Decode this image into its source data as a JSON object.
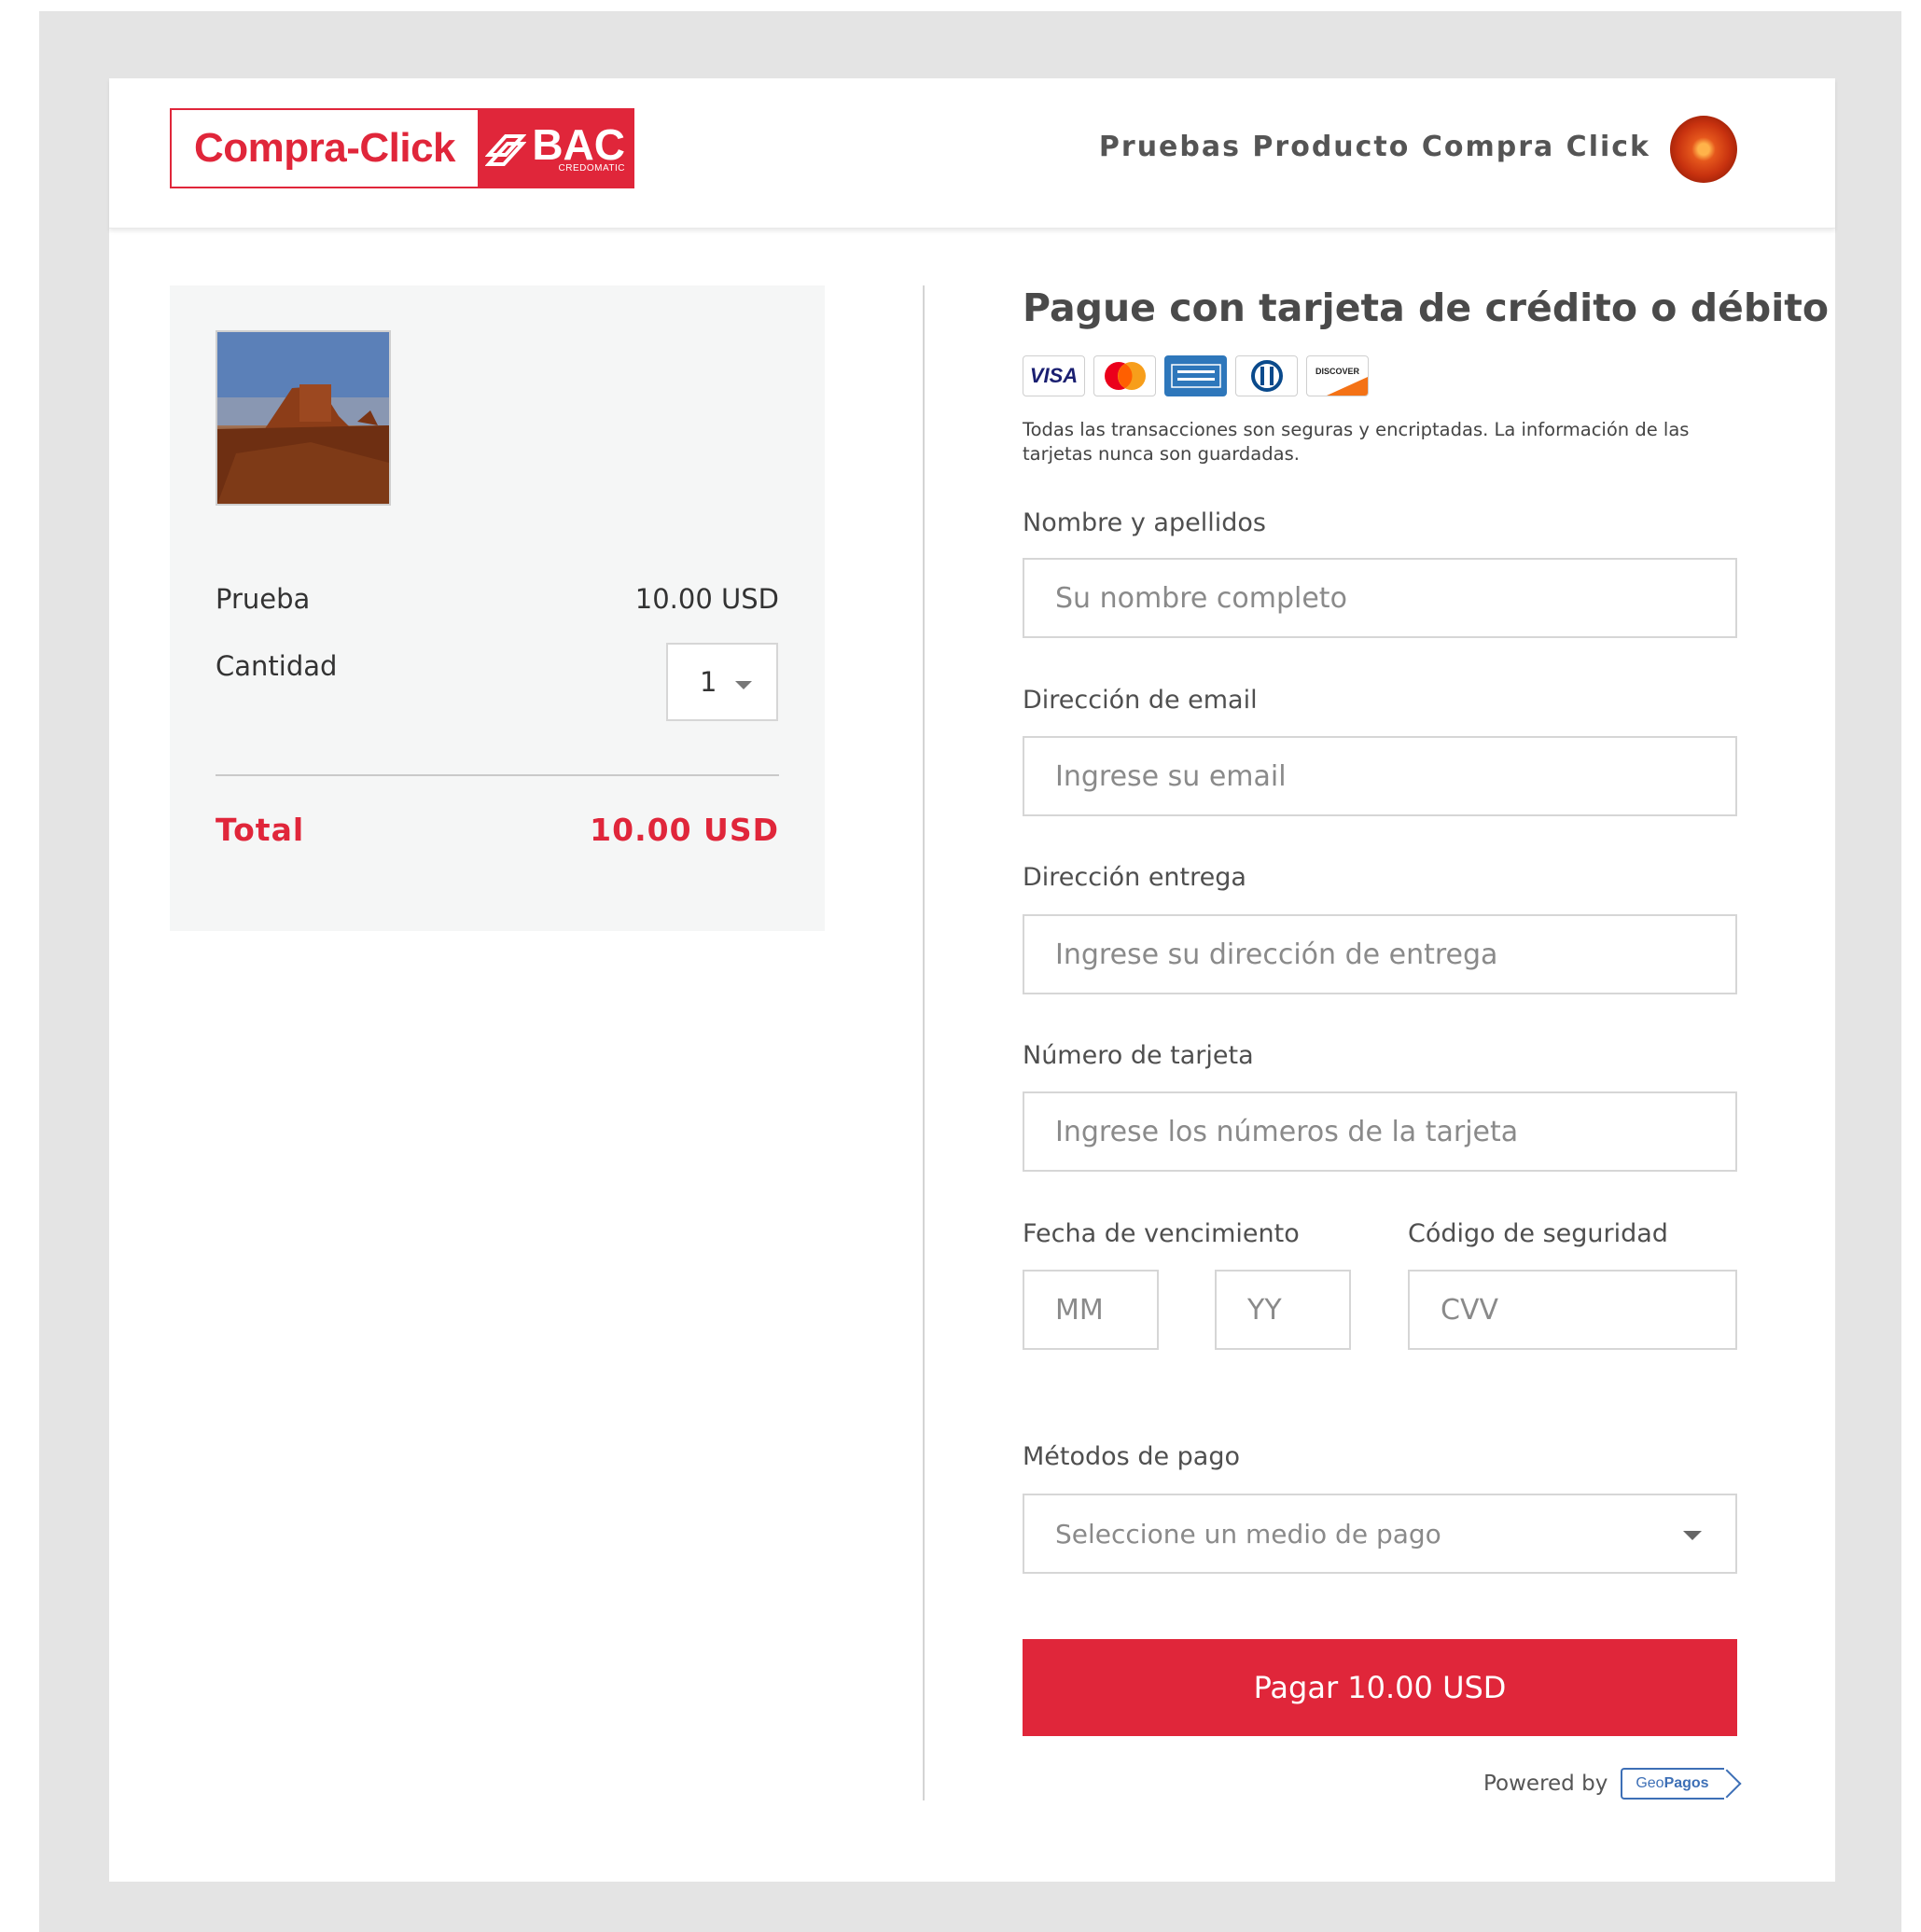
{
  "header": {
    "logo_text": "Compra-Click",
    "logo_bank": "BAC",
    "logo_bank_sub": "CREDOMATIC",
    "merchant_name": "Pruebas Producto Compra Click"
  },
  "summary": {
    "product_name": "Prueba",
    "product_price": "10.00 USD",
    "quantity_label": "Cantidad",
    "quantity_value": "1",
    "total_label": "Total",
    "total_value": "10.00 USD"
  },
  "form": {
    "title": "Pague con tarjeta de crédito o débito",
    "cards": [
      "visa",
      "mastercard",
      "american-express",
      "diners-club",
      "discover"
    ],
    "card_labels": {
      "visa": "VISA",
      "discover": "DISCOVER"
    },
    "disclaimer": "Todas las transacciones son seguras y encriptadas. La información de las tarjetas nunca son guardadas.",
    "name_label": "Nombre y apellidos",
    "name_placeholder": "Su nombre completo",
    "email_label": "Dirección de email",
    "email_placeholder": "Ingrese su email",
    "address_label": "Dirección entrega",
    "address_placeholder": "Ingrese su dirección de entrega",
    "card_number_label": "Número de tarjeta",
    "card_number_placeholder": "Ingrese los números de la tarjeta",
    "expiry_label": "Fecha de vencimiento",
    "month_placeholder": "MM",
    "year_placeholder": "YY",
    "cvv_label": "Código de seguridad",
    "cvv_placeholder": "CVV",
    "payment_methods_label": "Métodos de pago",
    "payment_methods_value": "Seleccione un medio de pago",
    "pay_button": "Pagar 10.00 USD",
    "powered_by": "Powered by",
    "powered_brand_a": "Geo",
    "powered_brand_b": "Pagos"
  },
  "colors": {
    "accent": "#e0263a",
    "frame": "#e4e4e4",
    "summary_bg": "#f5f6f6",
    "geopagos_blue": "#3d6fb6"
  }
}
